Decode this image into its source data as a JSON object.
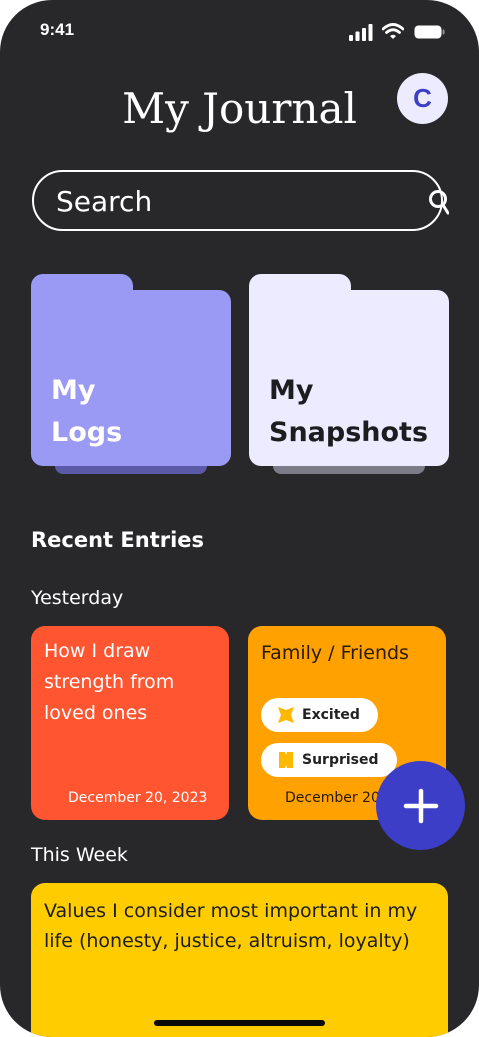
{
  "status_bar": {
    "time": "9:41"
  },
  "header": {
    "title": "My Journal",
    "avatar_initial": "C"
  },
  "search": {
    "placeholder": "Search",
    "value": ""
  },
  "folders": [
    {
      "line1": "My",
      "line2": "Logs",
      "color": "#9a9af4",
      "text_color": "#ffffff"
    },
    {
      "line1": "My",
      "line2": "Snapshots",
      "color": "#ecebff",
      "text_color": "#1d1d1f"
    }
  ],
  "recent": {
    "title": "Recent Entries",
    "groups": [
      {
        "label": "Yesterday"
      },
      {
        "label": "This Week"
      }
    ],
    "cards": [
      {
        "text": "How I draw strength from loved ones",
        "date": "December 20, 2023",
        "color": "#ff5631"
      },
      {
        "text": "Family / Friends",
        "date": "December 20, 2023",
        "color": "#ffa100",
        "tags": [
          {
            "label": "Excited"
          },
          {
            "label": "Surprised"
          }
        ]
      },
      {
        "text": "Values I consider most important in my life (honesty, justice, altruism, loyalty)",
        "color": "#ffcc00"
      }
    ]
  },
  "colors": {
    "background": "#28282a",
    "accent": "#3c3ec7",
    "tag_icon": "#ffb800"
  }
}
